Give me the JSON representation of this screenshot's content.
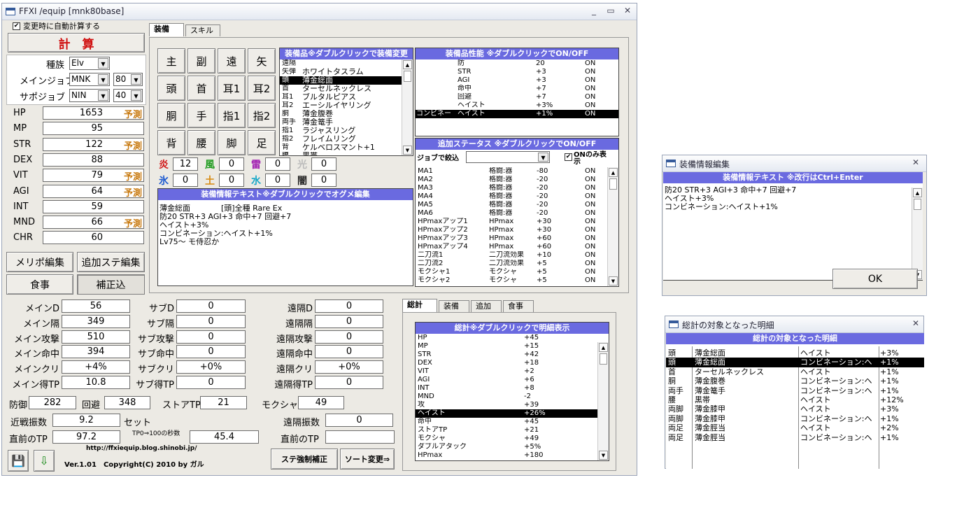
{
  "main_window": {
    "title": "FFXI /equip [mnk80base]",
    "auto_calc_label": "変更時に自動計算する",
    "auto_calc_checked": true,
    "calc_button": "計　算",
    "race_label": "種族",
    "race_value": "Elv",
    "main_job_label": "メインジョブ",
    "main_job_value": "MNK",
    "main_job_level": "80",
    "sub_job_label": "サポジョブ",
    "sub_job_value": "NIN",
    "sub_job_level": "40",
    "stats": [
      {
        "label": "HP",
        "value": "1653",
        "flag": "予測"
      },
      {
        "label": "MP",
        "value": "95",
        "flag": ""
      },
      {
        "label": "STR",
        "value": "122",
        "flag": "予測"
      },
      {
        "label": "DEX",
        "value": "88",
        "flag": ""
      },
      {
        "label": "VIT",
        "value": "79",
        "flag": "予測"
      },
      {
        "label": "AGI",
        "value": "64",
        "flag": "予測"
      },
      {
        "label": "INT",
        "value": "59",
        "flag": ""
      },
      {
        "label": "MND",
        "value": "66",
        "flag": "予測"
      },
      {
        "label": "CHR",
        "value": "60",
        "flag": ""
      }
    ],
    "btn_merit": "メリポ編集",
    "btn_addstat": "追加ステ編集",
    "btn_food": "食事",
    "btn_correction": "補正込",
    "tabs": [
      "装備",
      "スキル"
    ],
    "slots": [
      [
        "主",
        "副",
        "遠",
        "矢"
      ],
      [
        "頭",
        "首",
        "耳1",
        "耳2"
      ],
      [
        "胴",
        "手",
        "指1",
        "指2"
      ],
      [
        "背",
        "腰",
        "脚",
        "足"
      ]
    ],
    "elements": [
      {
        "label": "炎",
        "value": "12",
        "color": "#d01818"
      },
      {
        "label": "風",
        "value": "0",
        "color": "#1a9a1a"
      },
      {
        "label": "雷",
        "value": "0",
        "color": "#a01cb0"
      },
      {
        "label": "光",
        "value": "0",
        "color": "#bbbbbb"
      },
      {
        "label": "氷",
        "value": "0",
        "color": "#1a58d0"
      },
      {
        "label": "土",
        "value": "0",
        "color": "#d88a10"
      },
      {
        "label": "水",
        "value": "0",
        "color": "#18a8c8"
      },
      {
        "label": "闇",
        "value": "0",
        "color": "#222222"
      }
    ],
    "equip_list_header": "装備品※ダブルクリックで装備変更",
    "equip_list": [
      {
        "slot": "遠隔",
        "name": ""
      },
      {
        "slot": "矢弾",
        "name": "ホワイトタスラム"
      },
      {
        "slot": "頭",
        "name": "薄金総面",
        "selected": true
      },
      {
        "slot": "首",
        "name": "ターセルネックレス"
      },
      {
        "slot": "耳1",
        "name": "ブルタルピアス"
      },
      {
        "slot": "耳2",
        "name": "エーシルイヤリング"
      },
      {
        "slot": "胴",
        "name": "薄金腹巻"
      },
      {
        "slot": "両手",
        "name": "薄金篭手"
      },
      {
        "slot": "指1",
        "name": "ラジャスリング"
      },
      {
        "slot": "指2",
        "name": "フレイムリング"
      },
      {
        "slot": "背",
        "name": "ケルベロスマント+1"
      },
      {
        "slot": "腰",
        "name": "黒帯"
      }
    ],
    "perf_header": "装備品性能 ※ダブルクリックでON/OFF",
    "perf_rows": [
      {
        "a": "",
        "b": "防",
        "c": "20",
        "d": "ON"
      },
      {
        "a": "",
        "b": "STR",
        "c": "+3",
        "d": "ON"
      },
      {
        "a": "",
        "b": "AGI",
        "c": "+3",
        "d": "ON"
      },
      {
        "a": "",
        "b": "命中",
        "c": "+7",
        "d": "ON"
      },
      {
        "a": "",
        "b": "回避",
        "c": "+7",
        "d": "ON"
      },
      {
        "a": "",
        "b": "ヘイスト",
        "c": "+3%",
        "d": "ON"
      },
      {
        "a": "コンビネー",
        "b": "ヘイスト",
        "c": "+1%",
        "d": "ON",
        "selected": true
      }
    ],
    "add_status_header": "追加ステータス ※ダブルクリックでON/OFF",
    "job_filter_label": "ジョブで絞込",
    "only_on_label": "ONのみ表示",
    "add_status_rows": [
      {
        "a": "MA1",
        "b": "格闘:器",
        "c": "-80",
        "d": "ON"
      },
      {
        "a": "MA2",
        "b": "格闘:器",
        "c": "-20",
        "d": "ON"
      },
      {
        "a": "MA3",
        "b": "格闘:器",
        "c": "-20",
        "d": "ON"
      },
      {
        "a": "MA4",
        "b": "格闘:器",
        "c": "-20",
        "d": "ON"
      },
      {
        "a": "MA5",
        "b": "格闘:器",
        "c": "-20",
        "d": "ON"
      },
      {
        "a": "MA6",
        "b": "格闘:器",
        "c": "-20",
        "d": "ON"
      },
      {
        "a": "HPmaxアップ1",
        "b": "HPmax",
        "c": "+30",
        "d": "ON"
      },
      {
        "a": "HPmaxアップ2",
        "b": "HPmax",
        "c": "+30",
        "d": "ON"
      },
      {
        "a": "HPmaxアップ3",
        "b": "HPmax",
        "c": "+60",
        "d": "ON"
      },
      {
        "a": "HPmaxアップ4",
        "b": "HPmax",
        "c": "+60",
        "d": "ON"
      },
      {
        "a": "二刀流1",
        "b": "二刀流効果",
        "c": "+10",
        "d": "ON"
      },
      {
        "a": "二刀流2",
        "b": "二刀流効果",
        "c": "+5",
        "d": "ON"
      },
      {
        "a": "モクシャ1",
        "b": "モクシャ",
        "c": "+5",
        "d": "ON"
      },
      {
        "a": "モクシャ2",
        "b": "モクシャ",
        "c": "+5",
        "d": "ON"
      }
    ],
    "equip_text_header": "装備情報テキスト※ダブルクリックでオグメ編集",
    "equip_text": "薄金総面　　　　[頭]全種 Rare Ex\n防20 STR+3 AGI+3 命中+7 回避+7\nヘイスト+3%\nコンビネーション:ヘイスト+1%\nLv75～ モ侍忍か",
    "combat": [
      {
        "label": "メインD",
        "value": "56",
        "label2": "サブD",
        "value2": "0",
        "label3": "遠隔D",
        "value3": "0"
      },
      {
        "label": "メイン隔",
        "value": "349",
        "label2": "サブ隔",
        "value2": "0",
        "label3": "遠隔隔",
        "value3": "0"
      },
      {
        "label": "メイン攻撃",
        "value": "510",
        "label2": "サブ攻撃",
        "value2": "0",
        "label3": "遠隔攻撃",
        "value3": "0"
      },
      {
        "label": "メイン命中",
        "value": "394",
        "label2": "サブ命中",
        "value2": "0",
        "label3": "遠隔命中",
        "value3": "0"
      },
      {
        "label": "メインクリ",
        "value": "+4%",
        "label2": "サブクリ",
        "value2": "+0%",
        "label3": "遠隔クリ",
        "value3": "+0%"
      },
      {
        "label": "メイン得TP",
        "value": "10.8",
        "label2": "サブ得TP",
        "value2": "0",
        "label3": "遠隔得TP",
        "value3": "0"
      }
    ],
    "def_label": "防御",
    "def_value": "282",
    "eva_label": "回避",
    "eva_value": "348",
    "storetp_label": "ストアTP",
    "storetp_value": "21",
    "moksha_label": "モクシャ",
    "moksha_value": "49",
    "melee_swing_label": "近戦振数",
    "melee_swing_value": "9.2",
    "set_label": "セット",
    "ranged_swing_label": "遠隔振数",
    "ranged_swing_value": "0",
    "prev_tp_label": "直前のTP",
    "prev_tp_value": "97.2",
    "tp_to_100_label": "TP0⇒100の秒数",
    "tp_to_100_value": "45.4",
    "prev_tp2_label": "直前のTP",
    "prev_tp2_value": "",
    "url": "http://ffxiequip.blog.shinobi.jp/",
    "version": "Ver.1.01　Copyright(C) 2010 by ガル",
    "btn_force": "ステ強制補正",
    "btn_sort": "ソート変更⇒",
    "bottom_tabs": [
      "総計",
      "装備計",
      "追加計",
      "食事"
    ],
    "total_header": "総計※ダブルクリックで明細表示",
    "totals": [
      {
        "k": "HP",
        "v": "+45"
      },
      {
        "k": "MP",
        "v": "+15"
      },
      {
        "k": "STR",
        "v": "+42"
      },
      {
        "k": "DEX",
        "v": "+18"
      },
      {
        "k": "VIT",
        "v": "+2"
      },
      {
        "k": "AGI",
        "v": "+6"
      },
      {
        "k": "INT",
        "v": "+8"
      },
      {
        "k": "MND",
        "v": "-2"
      },
      {
        "k": "攻",
        "v": "+39"
      },
      {
        "k": "ヘイスト",
        "v": "+26%",
        "selected": true
      },
      {
        "k": "命中",
        "v": "+45"
      },
      {
        "k": "ストアTP",
        "v": "+21"
      },
      {
        "k": "モクシャ",
        "v": "+49"
      },
      {
        "k": "ダブルアタック",
        "v": "+5%"
      },
      {
        "k": "HPmax",
        "v": "+180"
      }
    ]
  },
  "edit_window": {
    "title": "装備情報編集",
    "header": "装備情報テキスト ※改行はCtrl+Enter",
    "text_lines": [
      "防20 STR+3 AGI+3 命中+7 回避+7",
      "ヘイスト+3%",
      "コンビネーション:ヘイスト+1%"
    ],
    "ok": "OK"
  },
  "detail_window": {
    "title": "総計の対象となった明細",
    "header": "総計の対象となった明細",
    "rows": [
      {
        "slot": "頭",
        "item": "薄金総面",
        "effect": "ヘイスト",
        "val": "+3%"
      },
      {
        "slot": "頭",
        "item": "薄金総面",
        "effect": "コンビネーション:ヘ",
        "val": "+1%",
        "selected": true
      },
      {
        "slot": "首",
        "item": "ターセルネックレス",
        "effect": "ヘイスト",
        "val": "+1%"
      },
      {
        "slot": "胴",
        "item": "薄金腹巻",
        "effect": "コンビネーション:ヘ",
        "val": "+1%"
      },
      {
        "slot": "両手",
        "item": "薄金篭手",
        "effect": "コンビネーション:ヘ",
        "val": "+1%"
      },
      {
        "slot": "腰",
        "item": "黒帯",
        "effect": "ヘイスト",
        "val": "+12%"
      },
      {
        "slot": "両脚",
        "item": "薄金膝甲",
        "effect": "ヘイスト",
        "val": "+3%"
      },
      {
        "slot": "両脚",
        "item": "薄金膝甲",
        "effect": "コンビネーション:ヘ",
        "val": "+1%"
      },
      {
        "slot": "両足",
        "item": "薄金脛当",
        "effect": "ヘイスト",
        "val": "+2%"
      },
      {
        "slot": "両足",
        "item": "薄金脛当",
        "effect": "コンビネーション:ヘ",
        "val": "+1%"
      }
    ]
  }
}
